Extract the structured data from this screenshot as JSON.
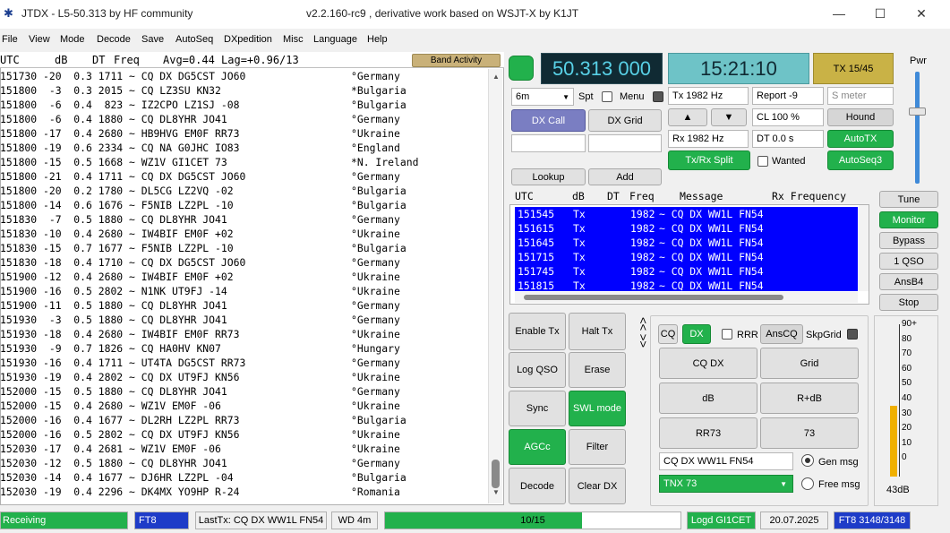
{
  "window": {
    "title_left": "JTDX  -  L5-50.313   by HF community",
    "title_center": "v2.2.160-rc9 , derivative work based on WSJT-X by K1JT",
    "minimize": "—",
    "maximize": "☐",
    "close": "✕"
  },
  "menu": [
    "File",
    "View",
    "Mode",
    "Decode",
    "Save",
    "AutoSeq",
    "DXpedition",
    "Misc",
    "Language",
    "Help"
  ],
  "decode_header": {
    "utc": "UTC",
    "db": "dB",
    "dt": "DT",
    "freq": "Freq",
    "avg": "Avg=0.44  Lag=+0.96/13",
    "band_activity": "Band Activity"
  },
  "decodes": [
    {
      "msg": "151730 -20  0.3 1711 ~ CQ DX DG5CST JO60",
      "cty": "°Germany"
    },
    {
      "msg": "151800  -3  0.3 2015 ~ CQ LZ3SU KN32",
      "cty": "*Bulgaria"
    },
    {
      "msg": "151800  -6  0.4  823 ~ IZ2CPO LZ1SJ -08",
      "cty": "°Bulgaria"
    },
    {
      "msg": "151800  -6  0.4 1880 ~ CQ DL8YHR JO41",
      "cty": "°Germany"
    },
    {
      "msg": "151800 -17  0.4 2680 ~ HB9HVG EM0F RR73",
      "cty": "°Ukraine"
    },
    {
      "msg": "151800 -19  0.6 2334 ~ CQ NA G0JHC IO83",
      "cty": "°England"
    },
    {
      "msg": "151800 -15  0.5 1668 ~ WZ1V GI1CET 73",
      "cty": "*N. Ireland"
    },
    {
      "msg": "151800 -21  0.4 1711 ~ CQ DX DG5CST JO60",
      "cty": "°Germany"
    },
    {
      "msg": "151800 -20  0.2 1780 ~ DL5CG LZ2VQ -02",
      "cty": "°Bulgaria"
    },
    {
      "msg": "151800 -14  0.6 1676 ~ F5NIB LZ2PL -10",
      "cty": "°Bulgaria"
    },
    {
      "msg": "151830  -7  0.5 1880 ~ CQ DL8YHR JO41",
      "cty": "°Germany"
    },
    {
      "msg": "151830 -10  0.4 2680 ~ IW4BIF EM0F +02",
      "cty": "°Ukraine"
    },
    {
      "msg": "151830 -15  0.7 1677 ~ F5NIB LZ2PL -10",
      "cty": "°Bulgaria"
    },
    {
      "msg": "151830 -18  0.4 1710 ~ CQ DX DG5CST JO60",
      "cty": "°Germany"
    },
    {
      "msg": "151900 -12  0.4 2680 ~ IW4BIF EM0F +02",
      "cty": "°Ukraine"
    },
    {
      "msg": "151900 -16  0.5 2802 ~ N1NK UT9FJ -14",
      "cty": "°Ukraine"
    },
    {
      "msg": "151900 -11  0.5 1880 ~ CQ DL8YHR JO41",
      "cty": "°Germany"
    },
    {
      "msg": "151930  -3  0.5 1880 ~ CQ DL8YHR JO41",
      "cty": "°Germany"
    },
    {
      "msg": "151930 -18  0.4 2680 ~ IW4BIF EM0F RR73",
      "cty": "°Ukraine"
    },
    {
      "msg": "151930  -9  0.7 1826 ~ CQ HA0HV KN07",
      "cty": "°Hungary"
    },
    {
      "msg": "151930 -16  0.4 1711 ~ UT4TA DG5CST RR73",
      "cty": "°Germany"
    },
    {
      "msg": "151930 -19  0.4 2802 ~ CQ DX UT9FJ KN56",
      "cty": "°Ukraine"
    },
    {
      "msg": "152000 -15  0.5 1880 ~ CQ DL8YHR JO41",
      "cty": "°Germany"
    },
    {
      "msg": "152000 -15  0.4 2680 ~ WZ1V EM0F -06",
      "cty": "°Ukraine"
    },
    {
      "msg": "152000 -16  0.4 1677 ~ DL2RH LZ2PL RR73",
      "cty": "°Bulgaria"
    },
    {
      "msg": "152000 -16  0.5 2802 ~ CQ DX UT9FJ KN56",
      "cty": "°Ukraine"
    },
    {
      "msg": "152030 -17  0.4 2681 ~ WZ1V EM0F -06",
      "cty": "°Ukraine"
    },
    {
      "msg": "152030 -12  0.5 1880 ~ CQ DL8YHR JO41",
      "cty": "°Germany"
    },
    {
      "msg": "152030 -14  0.4 1677 ~ DJ6HR LZ2PL -04",
      "cty": "°Bulgaria"
    },
    {
      "msg": "152030 -19  0.4 2296 ~ DK4MX YO9HP R-24",
      "cty": "°Romania"
    }
  ],
  "top": {
    "frequency": "50.313 000",
    "clock": "15:21:10",
    "tx_counter": "TX 15/45",
    "pwr_label": "Pwr",
    "band": "6m",
    "spt": "Spt",
    "menu": "Menu",
    "tx_freq": "Tx  1982  Hz",
    "rx_freq": "Rx  1982  Hz",
    "report": "Report  -9",
    "s_meter_placeholder": "S meter",
    "cl": "CL  100 %",
    "dt": "DT 0.0 s",
    "dx_call": "DX Call",
    "dx_grid": "DX Grid",
    "up": "▲",
    "down": "▼",
    "hound": "Hound",
    "autotx": "AutoTX",
    "txrx_split": "Tx/Rx Split",
    "wanted": "Wanted",
    "autoseq3": "AutoSeq3",
    "lookup": "Lookup",
    "add": "Add"
  },
  "rx_header": {
    "utc": "UTC",
    "db": "dB",
    "dt": "DT",
    "freq": "Freq",
    "message": "Message",
    "rxf": "Rx Frequency"
  },
  "rx_lines": [
    {
      "utc": "151545",
      "tx": "Tx",
      "freq": "1982",
      "msg": "~ CQ DX WW1L FN54"
    },
    {
      "utc": "151615",
      "tx": "Tx",
      "freq": "1982",
      "msg": "~ CQ DX WW1L FN54"
    },
    {
      "utc": "151645",
      "tx": "Tx",
      "freq": "1982",
      "msg": "~ CQ DX WW1L FN54"
    },
    {
      "utc": "151715",
      "tx": "Tx",
      "freq": "1982",
      "msg": "~ CQ DX WW1L FN54"
    },
    {
      "utc": "151745",
      "tx": "Tx",
      "freq": "1982",
      "msg": "~ CQ DX WW1L FN54"
    },
    {
      "utc": "151815",
      "tx": "Tx",
      "freq": "1982",
      "msg": "~ CQ DX WW1L FN54"
    }
  ],
  "right_buttons": {
    "tune": "Tune",
    "monitor": "Monitor",
    "bypass": "Bypass",
    "one_qso": "1 QSO",
    "ansb4": "AnsB4",
    "stop": "Stop"
  },
  "bottom_buttons": {
    "enable_tx": "Enable Tx",
    "halt_tx": "Halt Tx",
    "log_qso": "Log QSO",
    "erase": "Erase",
    "sync": "Sync",
    "swl_mode": "SWL mode",
    "agcc": "AGCc",
    "filter": "Filter",
    "decode": "Decode",
    "clear_dx": "Clear DX"
  },
  "tx_panel": {
    "cq": "CQ",
    "dx": "DX",
    "rrr": "RRR",
    "anscq": "AnsCQ",
    "skpgrid": "SkpGrid",
    "cq_dx": "CQ DX",
    "grid": "Grid",
    "db": "dB",
    "r_db": "R+dB",
    "rr73": "RR73",
    "n73": "73",
    "tx_message": "CQ DX WW1L FN54",
    "gen_msg": "Gen msg",
    "tnx": "TNX 73",
    "free_msg": "Free msg",
    "arrows": "<< >>"
  },
  "meter": {
    "ticks": [
      "90+",
      "80",
      "70",
      "60",
      "50",
      "40",
      "30",
      "20",
      "10",
      "0"
    ],
    "reading": "43dB",
    "level_db": 43
  },
  "status": {
    "receiving": "Receiving",
    "mode": "FT8",
    "last_tx": "LastTx: CQ DX WW1L FN54",
    "wd": "WD 4m",
    "progress": "10/15",
    "progress_fraction": 0.667,
    "logd": "Logd GI1CET",
    "date": "20.07.2025",
    "ft8_count": "FT8  3148/3148"
  }
}
